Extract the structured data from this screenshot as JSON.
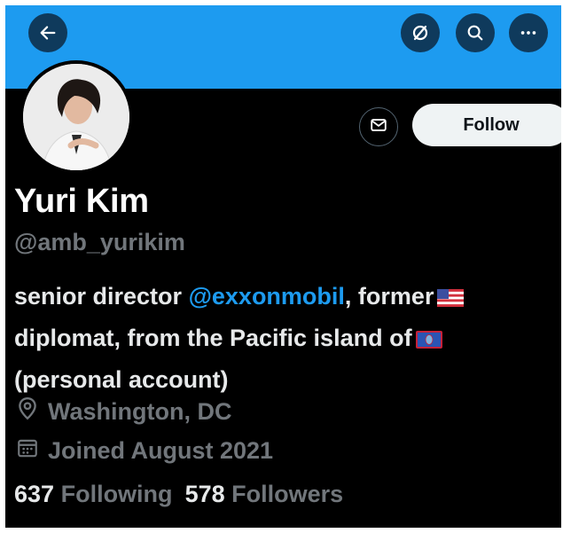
{
  "header": {
    "back_icon": "arrow-left-icon",
    "mute_icon": "circle-slash-icon",
    "search_icon": "search-icon",
    "more_icon": "more-dots-icon",
    "banner_color": "#1d9bf0"
  },
  "profile": {
    "name": "Yuri Kim",
    "handle": "@amb_yurikim",
    "bio": {
      "part1": "senior director ",
      "mention": "@exxonmobil",
      "part2": ", former",
      "line2": "diplomat, from the Pacific island of",
      "line3": "(personal account)"
    },
    "location": "Washington, DC",
    "joined": "Joined August 2021",
    "following_count": "637",
    "following_label": "Following",
    "followers_count": "578",
    "followers_label": "Followers"
  },
  "actions": {
    "message_icon": "envelope-icon",
    "follow_label": "Follow"
  },
  "colors": {
    "accent": "#1d9bf0",
    "muted_text": "#71767b",
    "primary_text": "#e7e9ea"
  }
}
